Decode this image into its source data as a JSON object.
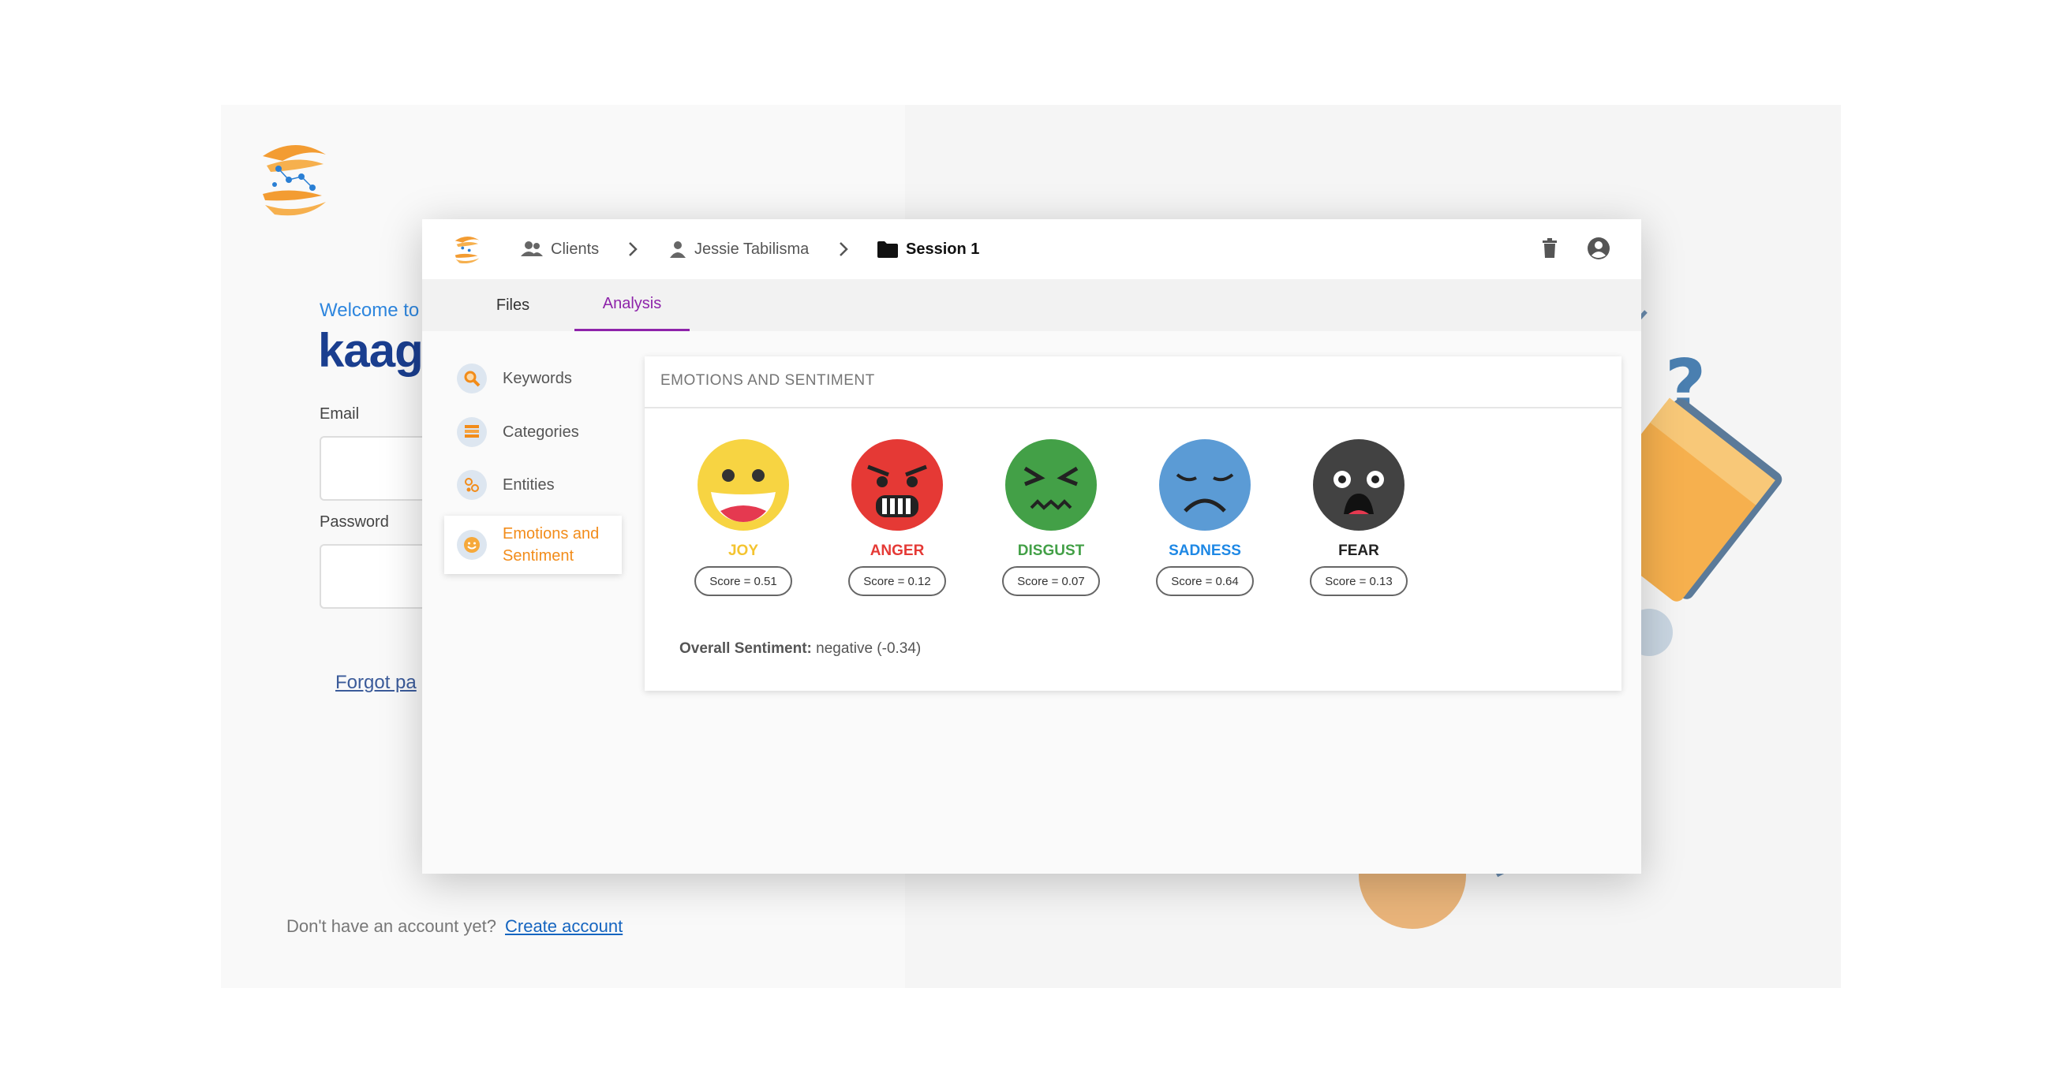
{
  "login": {
    "welcome": "Welcome to",
    "brand": "kaaga",
    "email_label": "Email",
    "password_label": "Password",
    "forgot": "Forgot pa",
    "no_account": "Don't have an account yet?",
    "create_account": "Create account"
  },
  "breadcrumb": {
    "clients": "Clients",
    "person": "Jessie Tabilisma",
    "session": "Session 1"
  },
  "tabs": {
    "files": "Files",
    "analysis": "Analysis"
  },
  "sidebar": {
    "items": [
      {
        "label": "Keywords",
        "icon": "magnifier-icon"
      },
      {
        "label": "Categories",
        "icon": "stack-icon"
      },
      {
        "label": "Entities",
        "icon": "entities-icon"
      },
      {
        "label": "Emotions and Sentiment",
        "icon": "smiley-icon"
      }
    ]
  },
  "card": {
    "title": "EMOTIONS AND SENTIMENT",
    "emotions": [
      {
        "label": "JOY",
        "score": "Score = 0.51",
        "color": "#f4c430"
      },
      {
        "label": "ANGER",
        "score": "Score = 0.12",
        "color": "#e53935"
      },
      {
        "label": "DISGUST",
        "score": "Score = 0.07",
        "color": "#43a047"
      },
      {
        "label": "SADNESS",
        "score": "Score = 0.64",
        "color": "#1e88e5"
      },
      {
        "label": "FEAR",
        "score": "Score = 0.13",
        "color": "#222222"
      }
    ],
    "overall_label": "Overall Sentiment:",
    "overall_value": "negative (-0.34)"
  },
  "colors": {
    "accent_tab": "#8e24aa",
    "accent_side": "#f28c1a",
    "brand": "#1a3e8f"
  }
}
